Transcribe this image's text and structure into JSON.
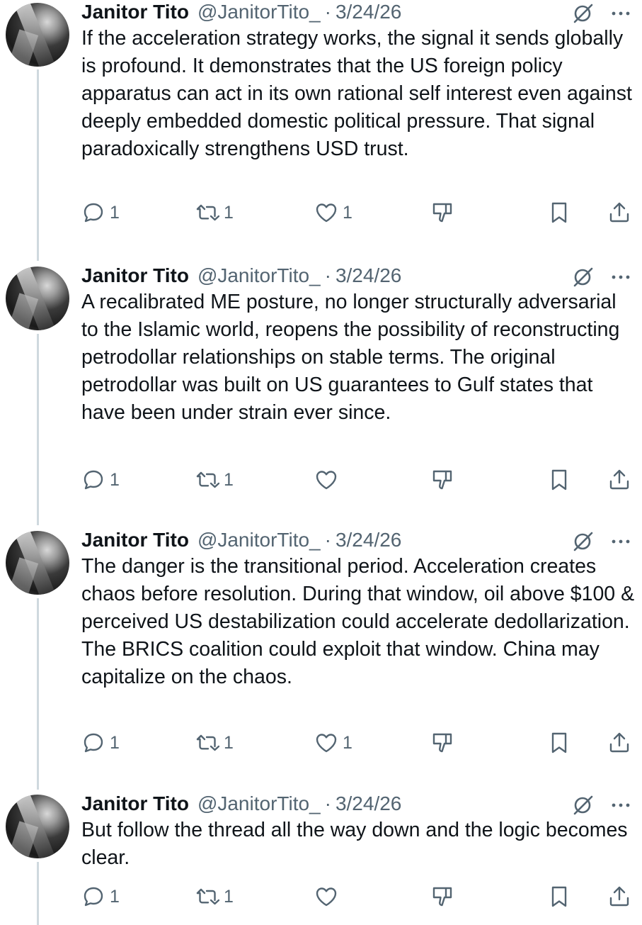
{
  "tweets": [
    {
      "name": "Janitor Tito",
      "handle": "@JanitorTito_",
      "dot": "·",
      "date": "3/24/26",
      "text": "If the acceleration strategy works, the signal it sends globally is profound. It demonstrates that the US foreign policy apparatus can act in its own rational self interest even against deeply embedded domestic political pressure. That signal paradoxically strengthens USD trust.",
      "replies": "1",
      "reposts": "1",
      "likes": "1"
    },
    {
      "name": "Janitor Tito",
      "handle": "@JanitorTito_",
      "dot": "·",
      "date": "3/24/26",
      "text": "A recalibrated ME posture, no longer structurally adversarial to the Islamic world, reopens the possibility of reconstructing petrodollar relationships on stable terms. The original petrodollar was built on US guarantees to Gulf states that have been under strain ever since.",
      "replies": "1",
      "reposts": "1",
      "likes": ""
    },
    {
      "name": "Janitor Tito",
      "handle": "@JanitorTito_",
      "dot": "·",
      "date": "3/24/26",
      "text": "The danger is the transitional period. Acceleration creates chaos before resolution. During that window, oil above $100 & perceived US destabilization could accelerate dedollarization. The BRICS coalition could exploit that window. China may capitalize on the chaos.",
      "replies": "1",
      "reposts": "1",
      "likes": "1"
    },
    {
      "name": "Janitor Tito",
      "handle": "@JanitorTito_",
      "dot": "·",
      "date": "3/24/26",
      "text": "But follow the thread all the way down and the logic becomes clear.",
      "replies": "1",
      "reposts": "1",
      "likes": ""
    }
  ],
  "icons": {
    "reply": "reply-icon",
    "repost": "repost-icon",
    "like": "heart-icon",
    "dislike": "dislike-icon",
    "bookmark": "bookmark-icon",
    "share": "share-icon",
    "grok": "grok-icon",
    "more": "more-icon"
  },
  "colors": {
    "text": "#0f1419",
    "secondary": "#536471",
    "thread_line": "#cfd9de"
  }
}
